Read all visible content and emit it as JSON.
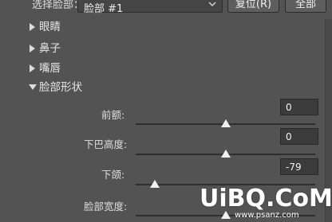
{
  "topbar": {
    "face_label": "选择脸部：",
    "face_select_value": "脸部 #1",
    "reset_button": "复位(R)",
    "all_button": "全部"
  },
  "sections": [
    {
      "label": "眼睛",
      "expanded": false
    },
    {
      "label": "鼻子",
      "expanded": false
    },
    {
      "label": "嘴唇",
      "expanded": false
    },
    {
      "label": "脸部形状",
      "expanded": true
    }
  ],
  "sliders": [
    {
      "label": "前额:",
      "value": "0",
      "level": 0.5
    },
    {
      "label": "下巴高度:",
      "value": "0",
      "level": 0.5
    },
    {
      "label": "下颌:",
      "value": "-79",
      "level": 0.105
    },
    {
      "label": "脸部宽度:",
      "value": "",
      "level": 0.5
    }
  ],
  "watermark": {
    "text": "UiBQ.CoM",
    "url": "www.psanz.com"
  },
  "colors": {
    "background": "#535353",
    "field": "#3b3b3b",
    "thumb": "#f0f0f0",
    "watermark_accent": "#22b14c"
  }
}
